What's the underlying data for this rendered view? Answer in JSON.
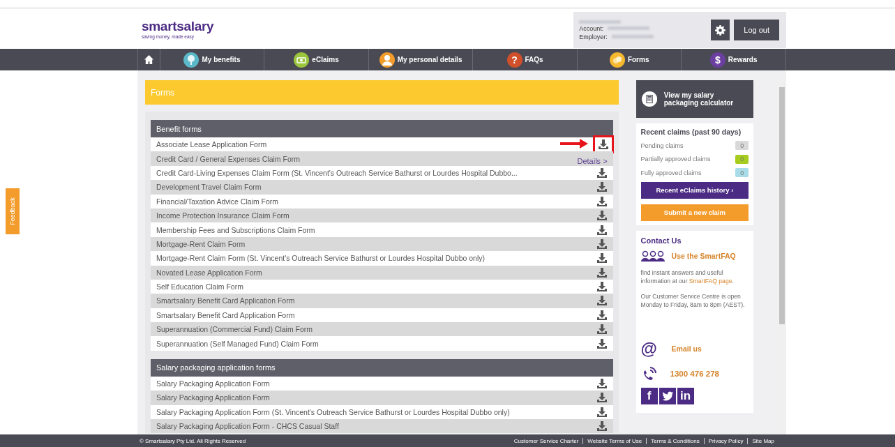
{
  "header": {
    "logo": "smartsalary",
    "tagline": "saving money, made easy",
    "account_labels": [
      "Account:",
      "Employer:"
    ],
    "logout": "Log out"
  },
  "nav": [
    {
      "kind": "home"
    },
    {
      "kind": "tree",
      "label": "My benefits",
      "color": "#5bb8c8"
    },
    {
      "kind": "cash",
      "label": "eClaims",
      "color": "#9bc53d"
    },
    {
      "kind": "person",
      "label": "My personal details",
      "color": "#f39c2c"
    },
    {
      "kind": "question",
      "label": "FAQs",
      "color": "#d0502b",
      "glyph": "?"
    },
    {
      "kind": "coins",
      "label": "Forms",
      "color": "#f5b82e"
    },
    {
      "kind": "dollar",
      "label": "Rewards",
      "color": "#6b3fa0",
      "glyph": "$"
    }
  ],
  "feedback": "Feedback",
  "page_title": "Forms",
  "sections": [
    {
      "title": "Benefit forms",
      "rows": [
        {
          "label": "Associate Lease Application Form",
          "kind": "download",
          "highlighted": true
        },
        {
          "label": "Credit Card / General Expenses Claim Form",
          "kind": "details",
          "action": "Details >",
          "highlighted": false
        },
        {
          "label": "Credit Card-Living Expenses Claim Form (St. Vincent's Outreach Service Bathurst or Lourdes Hospital Dubbo...",
          "kind": "download",
          "highlighted": false
        },
        {
          "label": "Development Travel Claim Form",
          "kind": "download",
          "highlighted": false
        },
        {
          "label": "Financial/Taxation Advice Claim Form",
          "kind": "download",
          "highlighted": false
        },
        {
          "label": "Income Protection Insurance Claim Form",
          "kind": "download",
          "highlighted": false
        },
        {
          "label": "Membership Fees and Subscriptions Claim Form",
          "kind": "download",
          "highlighted": false
        },
        {
          "label": "Mortgage-Rent Claim Form",
          "kind": "download",
          "highlighted": false
        },
        {
          "label": "Mortgage-Rent Claim Form (St. Vincent's Outreach Service Bathurst or Lourdes Hospital Dubbo only)",
          "kind": "download",
          "highlighted": false
        },
        {
          "label": "Novated Lease Application Form",
          "kind": "download",
          "highlighted": false
        },
        {
          "label": "Self Education Claim Form",
          "kind": "download",
          "highlighted": false
        },
        {
          "label": "Smartsalary Benefit Card Application Form",
          "kind": "download",
          "highlighted": false
        },
        {
          "label": "Smartsalary Benefit Card Application Form",
          "kind": "download",
          "highlighted": false
        },
        {
          "label": "Superannuation (Commercial Fund) Claim Form",
          "kind": "download",
          "highlighted": false
        },
        {
          "label": "Superannuation (Self Managed Fund) Claim Form",
          "kind": "download",
          "highlighted": false
        }
      ]
    },
    {
      "title": "Salary packaging application forms",
      "rows": [
        {
          "label": "Salary Packaging Application Form",
          "kind": "download",
          "highlighted": false
        },
        {
          "label": "Salary Packaging Application Form",
          "kind": "download",
          "highlighted": false
        },
        {
          "label": "Salary Packaging Application Form (St. Vincent's Outreach Service Bathurst or Lourdes Hospital Dubbo only)",
          "kind": "download",
          "highlighted": false
        },
        {
          "label": "Salary Packaging Application Form - CHCS Casual Staff",
          "kind": "download",
          "highlighted": false
        }
      ]
    }
  ],
  "sidebar": {
    "calculator": "View my salary packaging calculator",
    "claims_title": "Recent claims (past 90 days)",
    "claims": [
      {
        "label": "Pending claims",
        "count": "0",
        "color": "#d9d9d9"
      },
      {
        "label": "Partially approved claims",
        "count": "0",
        "color": "#a6cc1e"
      },
      {
        "label": "Fully approved claims",
        "count": "0",
        "color": "#a8dce8"
      }
    ],
    "history_button": "Recent eClaims history  ›",
    "submit_button": "Submit a new claim",
    "contact_title": "Contact Us",
    "faq_link": "Use the SmartFAQ",
    "faq_text_before": "find instant answers and useful information at our ",
    "faq_text_link": "SmartFAQ page",
    "faq_text_after": ".",
    "hours": "Our Customer Service Centre is open Monday to Friday, 8am to 8pm (AEST).",
    "email_glyph": "@",
    "email": "Email us",
    "phone": "1300 476 278",
    "social": [
      {
        "kind": "facebook",
        "glyph": "f"
      },
      {
        "kind": "twitter"
      },
      {
        "kind": "linkedin",
        "glyph": "in"
      }
    ]
  },
  "footer": {
    "copyright": "© Smartsalary Pty Ltd. All Rights Reserved",
    "links": [
      "Customer Service Charter",
      "Website Terms of Use",
      "Terms & Conditions",
      "Privacy Policy",
      "Site Map"
    ]
  }
}
